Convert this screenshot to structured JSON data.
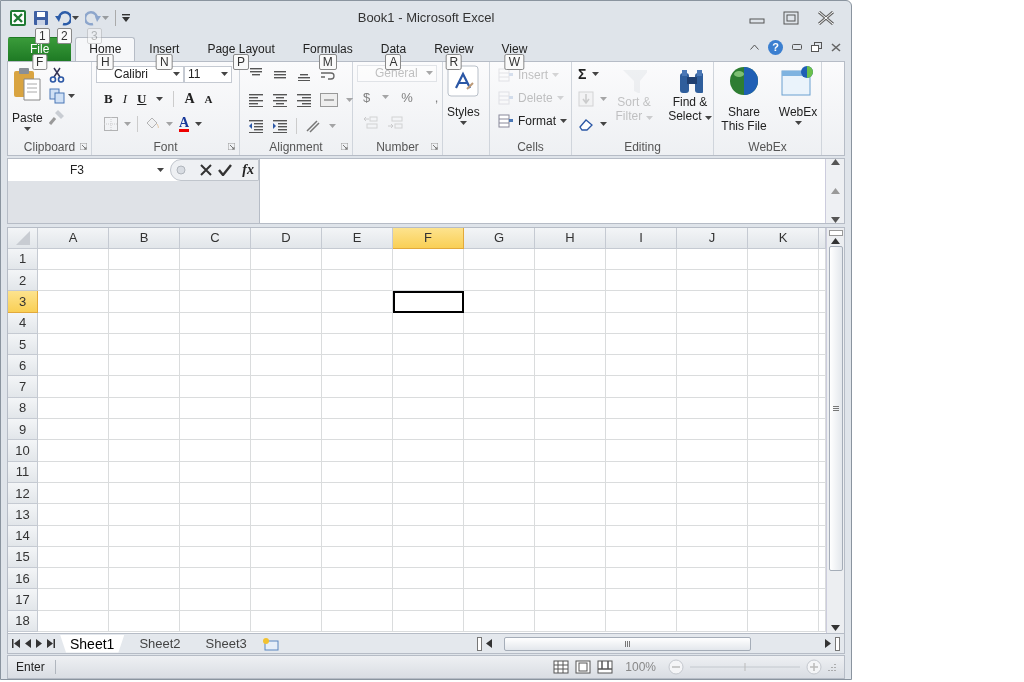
{
  "window": {
    "title": "Book1 - Microsoft Excel"
  },
  "quick_access": [
    {
      "keytip": "1",
      "disabled": false
    },
    {
      "keytip": "2",
      "disabled": false
    },
    {
      "keytip": "3",
      "disabled": true
    }
  ],
  "help": "?",
  "tabs": [
    {
      "label": "File",
      "kind": "file",
      "keytip": "F",
      "selected": false
    },
    {
      "label": "Home",
      "kind": "tab",
      "keytip": "H",
      "selected": true
    },
    {
      "label": "Insert",
      "kind": "tab",
      "keytip": "N",
      "selected": false
    },
    {
      "label": "Page Layout",
      "kind": "tab",
      "keytip": "P",
      "selected": false
    },
    {
      "label": "Formulas",
      "kind": "tab",
      "keytip": "M",
      "selected": false
    },
    {
      "label": "Data",
      "kind": "tab",
      "keytip": "A",
      "selected": false
    },
    {
      "label": "Review",
      "kind": "tab",
      "keytip": "R",
      "selected": false
    },
    {
      "label": "View",
      "kind": "tab",
      "keytip": "W",
      "selected": false
    }
  ],
  "ribbon": {
    "clipboard": {
      "label": "Clipboard",
      "paste": "Paste"
    },
    "font": {
      "label": "Font",
      "font_name": "Calibri",
      "font_size": "11",
      "bold": "B",
      "italic": "I",
      "underline": "U",
      "grow": "A",
      "shrink": "A",
      "font_color_button": "A",
      "borders_disabled": true,
      "fill_disabled": true
    },
    "alignment": {
      "label": "Alignment"
    },
    "number": {
      "label": "Number",
      "format": "General",
      "currency": "$",
      "percent": "%",
      "comma": ",",
      "disabled": true
    },
    "styles": {
      "button": "Styles"
    },
    "cells": {
      "label": "Cells",
      "buttons": [
        {
          "label": "Insert",
          "disabled": true
        },
        {
          "label": "Delete",
          "disabled": true
        },
        {
          "label": "Format",
          "disabled": false
        }
      ]
    },
    "editing": {
      "label": "Editing",
      "autosum": "Σ",
      "fill_disabled": true,
      "sort": {
        "label": "Sort & Filter",
        "disabled": true
      },
      "find": {
        "label": "Find & Select",
        "disabled": false
      }
    },
    "webex": {
      "label": "WebEx",
      "buttons": [
        {
          "label": "Share This File"
        },
        {
          "label": "WebEx"
        }
      ]
    }
  },
  "formula_bar": {
    "name_box": "F3",
    "insert_function": "fx"
  },
  "grid": {
    "columns": [
      {
        "label": "A",
        "selected": false
      },
      {
        "label": "B",
        "selected": false
      },
      {
        "label": "C",
        "selected": false
      },
      {
        "label": "D",
        "selected": false
      },
      {
        "label": "E",
        "selected": false
      },
      {
        "label": "F",
        "selected": true
      },
      {
        "label": "G",
        "selected": false
      },
      {
        "label": "H",
        "selected": false
      },
      {
        "label": "I",
        "selected": false
      },
      {
        "label": "J",
        "selected": false
      },
      {
        "label": "K",
        "selected": false
      }
    ],
    "rows": [
      {
        "label": "1",
        "selected": false
      },
      {
        "label": "2",
        "selected": false
      },
      {
        "label": "3",
        "selected": true
      },
      {
        "label": "4",
        "selected": false
      },
      {
        "label": "5",
        "selected": false
      },
      {
        "label": "6",
        "selected": false
      },
      {
        "label": "7",
        "selected": false
      },
      {
        "label": "8",
        "selected": false
      },
      {
        "label": "9",
        "selected": false
      },
      {
        "label": "10",
        "selected": false
      },
      {
        "label": "11",
        "selected": false
      },
      {
        "label": "12",
        "selected": false
      },
      {
        "label": "13",
        "selected": false
      },
      {
        "label": "14",
        "selected": false
      },
      {
        "label": "15",
        "selected": false
      },
      {
        "label": "16",
        "selected": false
      },
      {
        "label": "17",
        "selected": false
      },
      {
        "label": "18",
        "selected": false
      }
    ]
  },
  "sheets": [
    {
      "label": "Sheet1",
      "selected": true
    },
    {
      "label": "Sheet2",
      "selected": false
    },
    {
      "label": "Sheet3",
      "selected": false
    }
  ],
  "status_bar": {
    "mode": "Enter",
    "zoom": "100%"
  }
}
